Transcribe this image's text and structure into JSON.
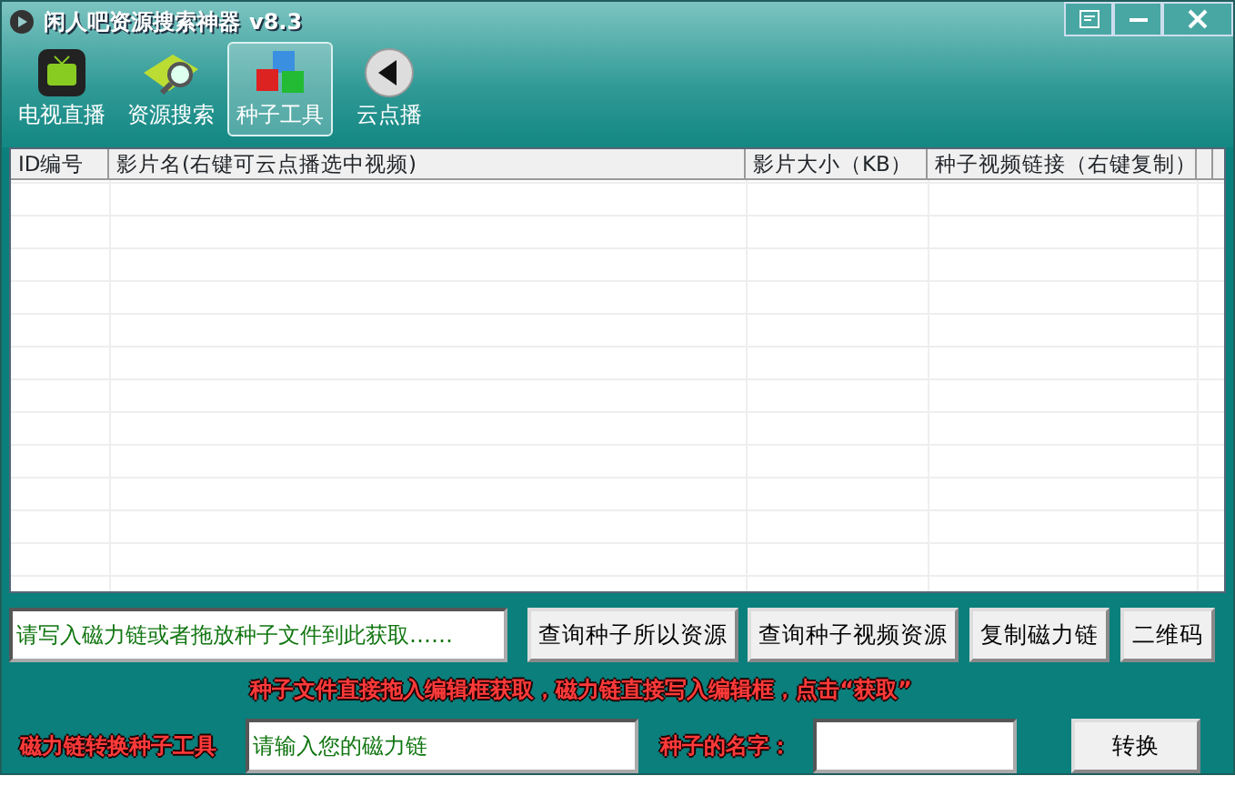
{
  "window": {
    "title": "闲人吧资源搜索神器",
    "version": "v8.3",
    "controls": [
      {
        "kind": "menu"
      },
      {
        "kind": "minimize"
      },
      {
        "kind": "close"
      }
    ]
  },
  "toolbar": [
    {
      "label": "电视直播",
      "kind": "tv",
      "selected": false
    },
    {
      "label": "资源搜索",
      "kind": "search",
      "selected": false
    },
    {
      "label": "种子工具",
      "kind": "cubes",
      "selected": true
    },
    {
      "label": "云点播",
      "kind": "back",
      "selected": false
    }
  ],
  "table": {
    "columns": [
      "ID编号",
      "影片名(右键可云点播选中视频)",
      "影片大小（KB）",
      "种子视频链接（右键复制）"
    ]
  },
  "magnet_input": {
    "value": "请写入磁力链或者拖放种子文件到此获取……"
  },
  "buttons": [
    "查询种子所以资源",
    "查询种子视频资源",
    "复制磁力链",
    "二维码"
  ],
  "hint": "种子文件直接拖入编辑框获取，磁力链直接写入编辑框，点击“获取”",
  "converter": {
    "label": "磁力链转换种子工具",
    "input": {
      "value": "请输入您的磁力链"
    },
    "name_label": "种子的名字：",
    "button": "转换"
  }
}
